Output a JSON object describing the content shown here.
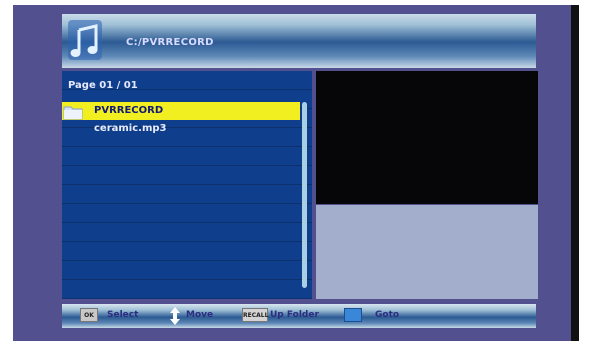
{
  "header": {
    "path": "C:/PVRRECORD"
  },
  "browser": {
    "page_label": "Page  01 / 01",
    "items": [
      {
        "label": "PVRRECORD",
        "type": "folder",
        "selected": true
      },
      {
        "label": "ceramic.mp3",
        "type": "file",
        "selected": false
      }
    ]
  },
  "footer": {
    "hints": [
      {
        "key": "OK",
        "label": "Select"
      },
      {
        "key": "arrow-updown-icon",
        "label": "Move"
      },
      {
        "key": "RECALL",
        "label": "Up Folder"
      },
      {
        "key": "blue-key",
        "label": "Goto"
      }
    ]
  },
  "colors": {
    "background": "#53508f",
    "list_bg": "#0f3f8c",
    "highlight": "#f2ef20",
    "highlight_text": "#121a7a",
    "preview_video": "#060608",
    "preview_info": "#a3aecd",
    "blue_key": "#3a86d8"
  }
}
